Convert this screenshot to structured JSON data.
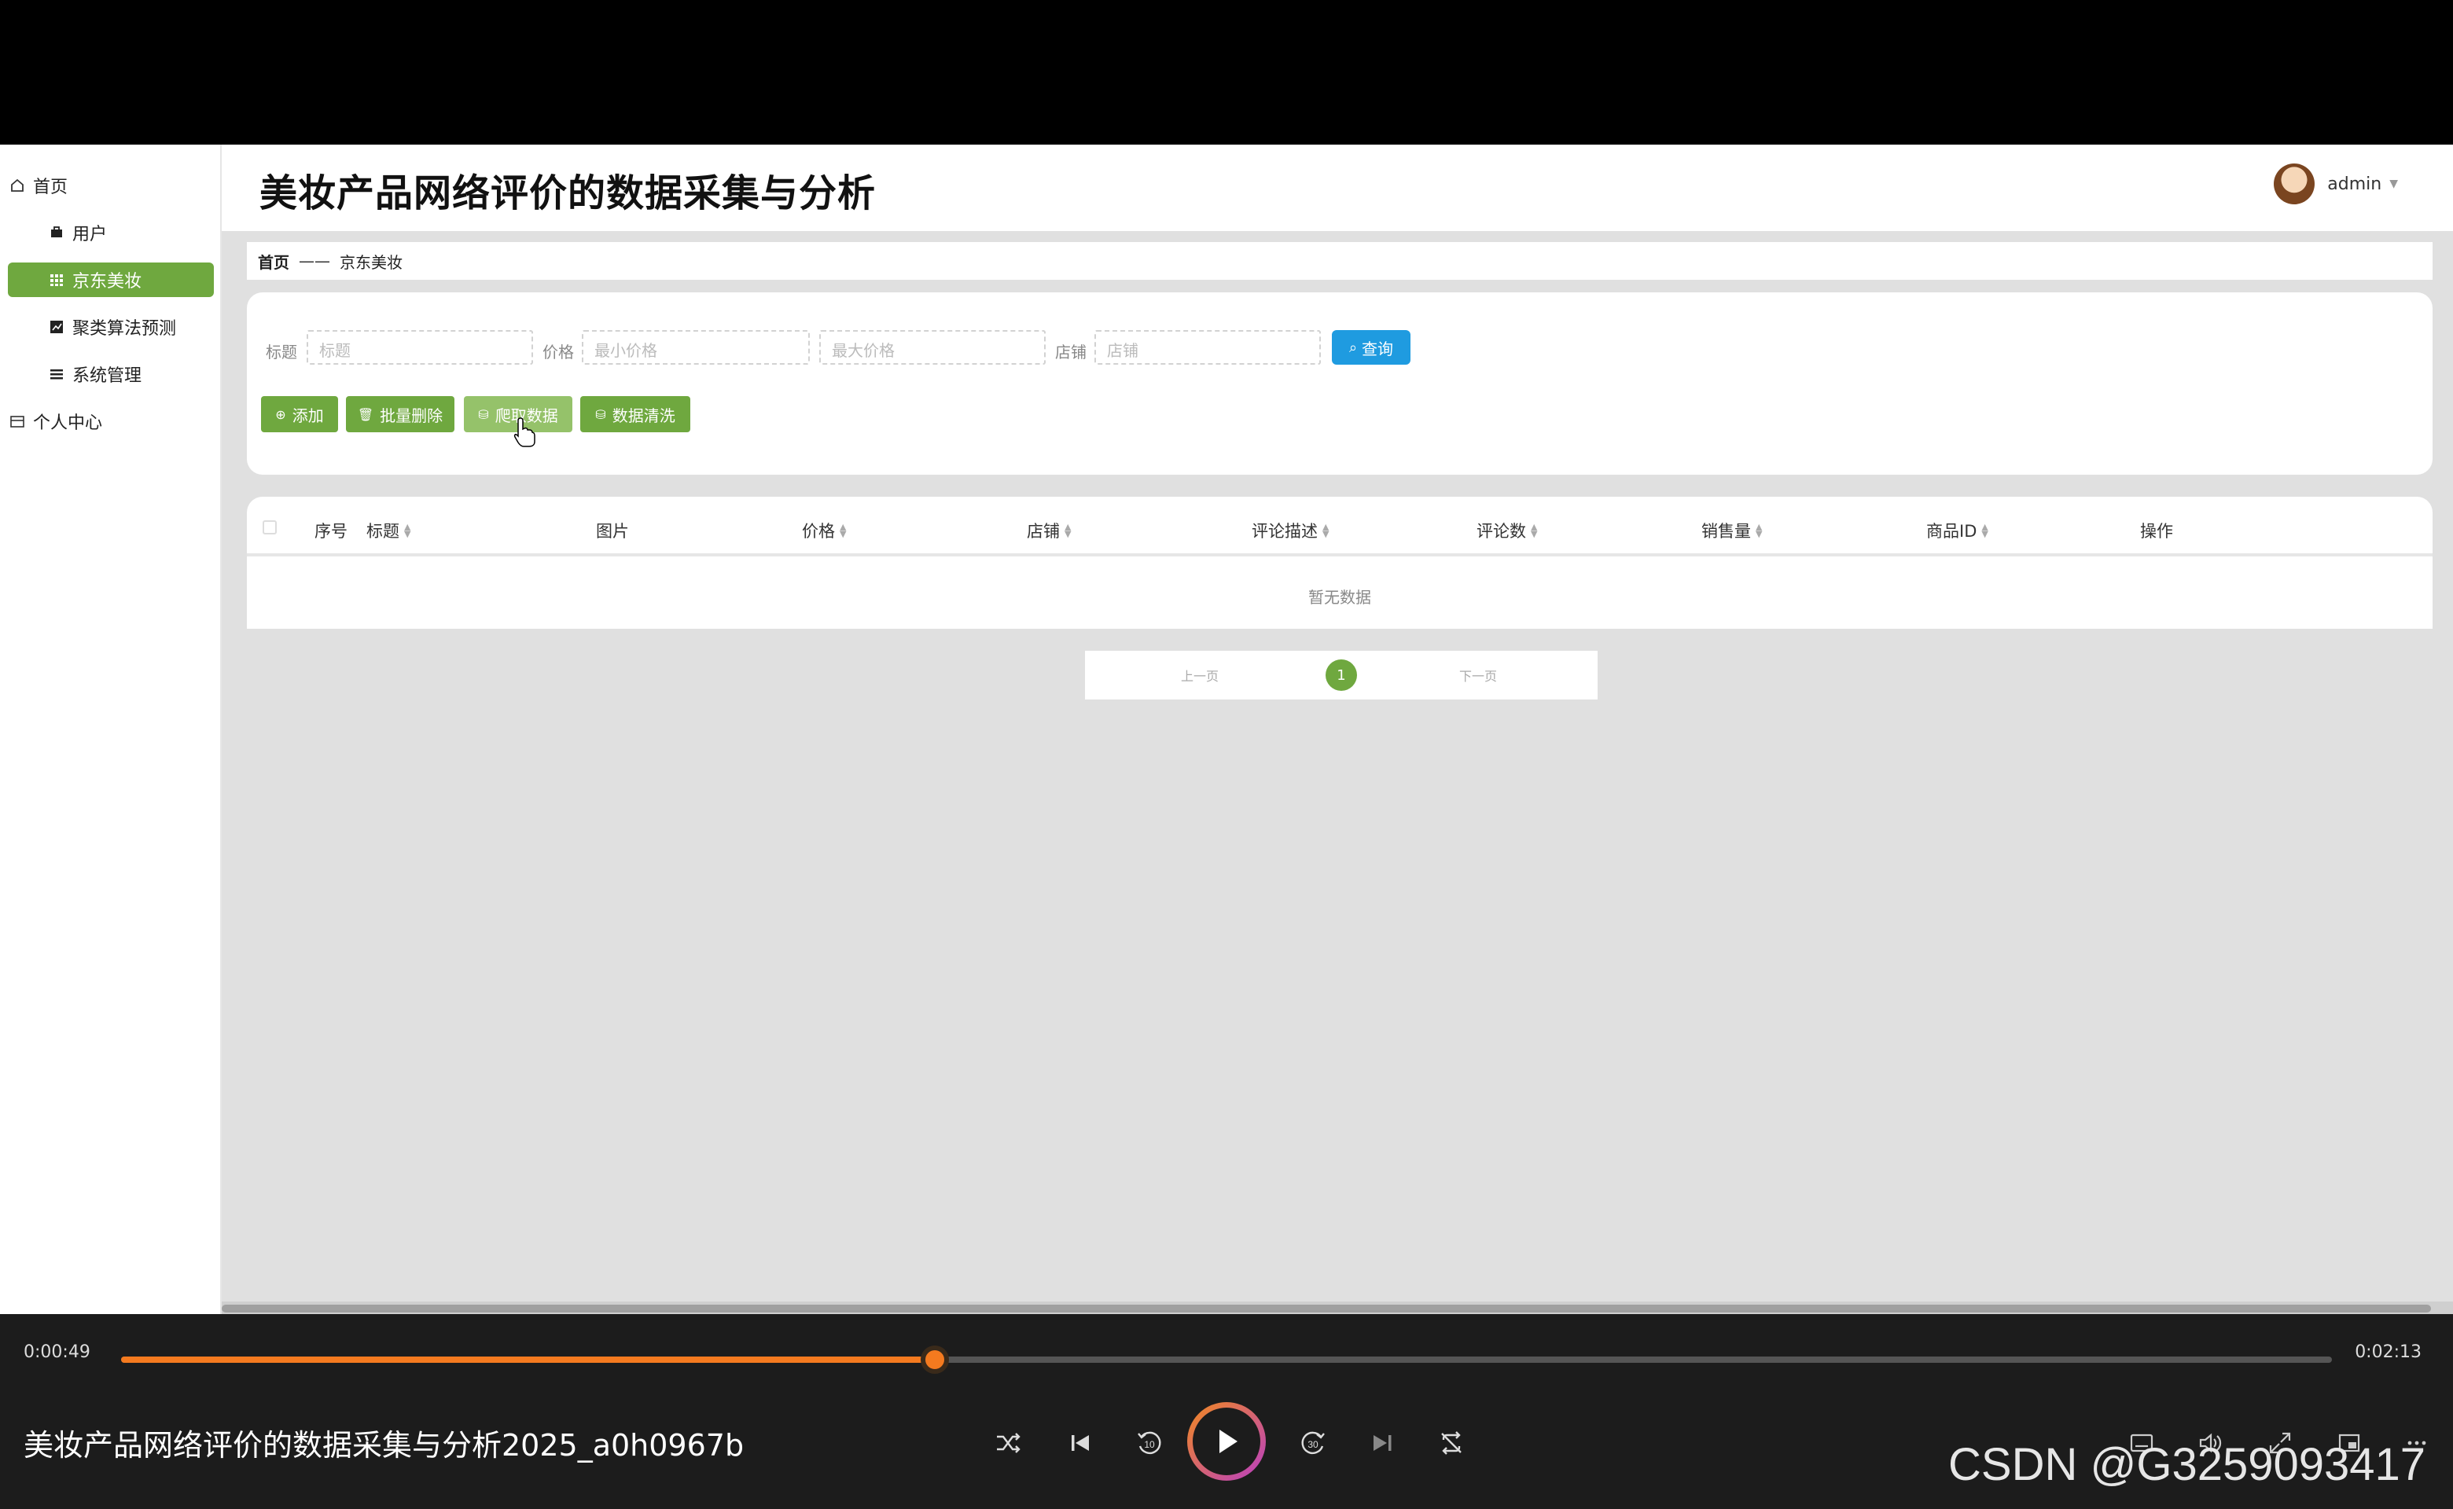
{
  "app": {
    "title": "美妆产品网络评价的数据采集与分析"
  },
  "user": {
    "name": "admin"
  },
  "sidebar": {
    "items": [
      {
        "label": "首页",
        "icon": "home-icon"
      },
      {
        "label": "用户",
        "icon": "briefcase-icon"
      },
      {
        "label": "京东美妆",
        "icon": "grid-icon",
        "active": true
      },
      {
        "label": "聚类算法预测",
        "icon": "chart-icon"
      },
      {
        "label": "系统管理",
        "icon": "menu-icon"
      },
      {
        "label": "个人中心",
        "icon": "folder-icon"
      }
    ]
  },
  "breadcrumb": {
    "home": "首页",
    "separator": "——",
    "current": "京东美妆"
  },
  "search": {
    "title_label": "标题",
    "title_placeholder": "标题",
    "price_label": "价格",
    "min_price_placeholder": "最小价格",
    "max_price_placeholder": "最大价格",
    "shop_label": "店铺",
    "shop_placeholder": "店铺",
    "query_button": "查询"
  },
  "actions": {
    "add": "添加",
    "batch_delete": "批量删除",
    "crawl": "爬取数据",
    "clean": "数据清洗"
  },
  "table": {
    "columns": [
      "序号",
      "标题",
      "图片",
      "价格",
      "店铺",
      "评论描述",
      "评论数",
      "销售量",
      "商品ID",
      "操作"
    ],
    "empty_text": "暂无数据"
  },
  "pagination": {
    "prev": "上一页",
    "current": "1",
    "next": "下一页"
  },
  "player": {
    "current_time": "0:00:49",
    "total_time": "0:02:13",
    "progress": 0.368,
    "video_title": "美妆产品网络评价的数据采集与分析2025_a0h0967b",
    "watermark": "CSDN @G3259093417"
  },
  "colors": {
    "accent_green": "#6fa83f",
    "query_blue": "#1f9be0",
    "progress_orange": "#f47a1f"
  }
}
